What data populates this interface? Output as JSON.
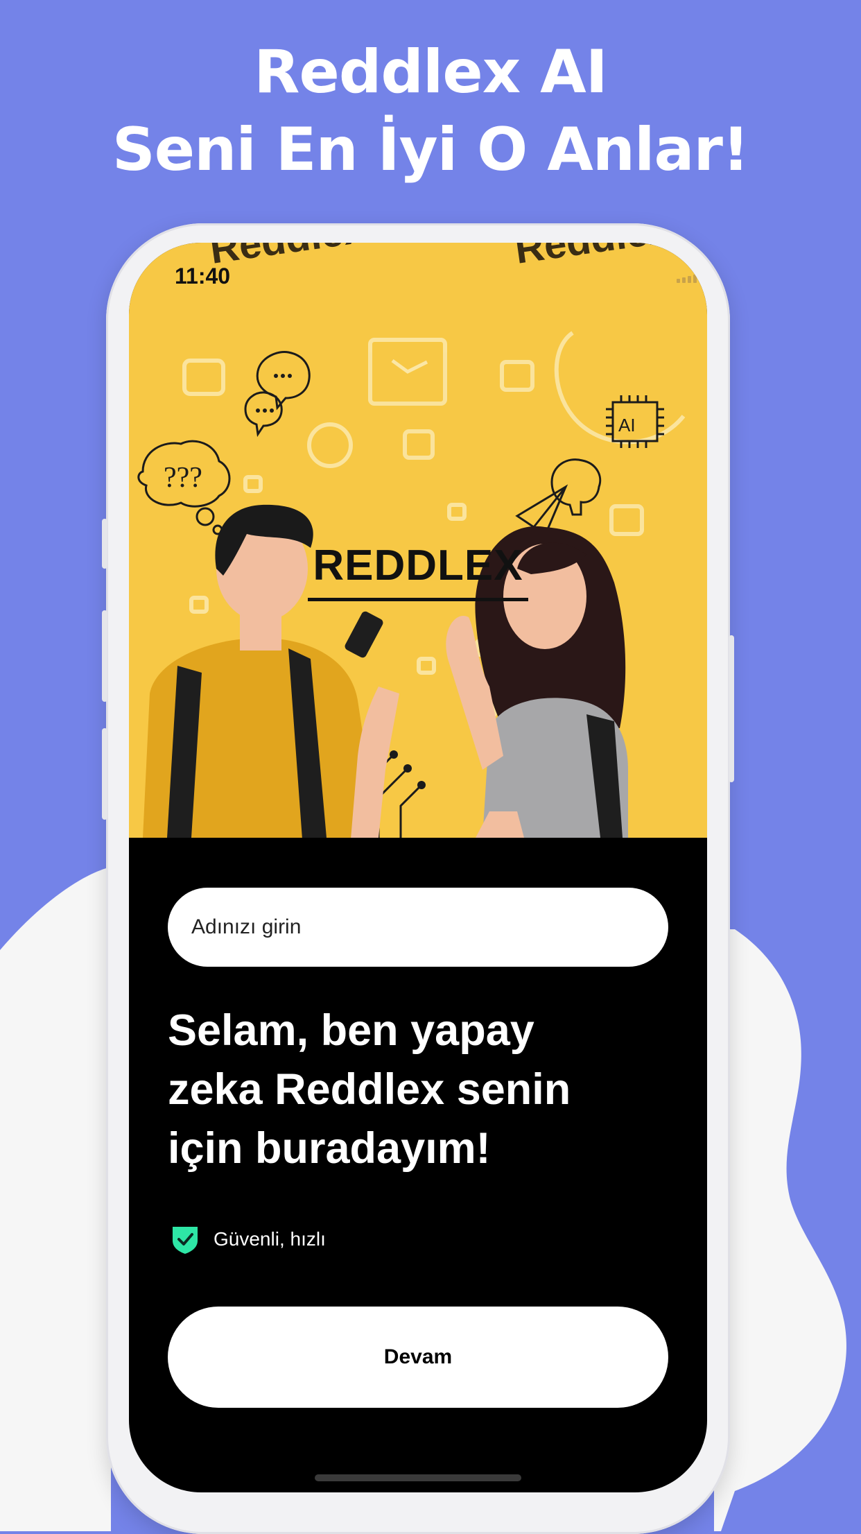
{
  "headline": {
    "line1": "Reddlex AI",
    "line2": "Seni En İyi O Anlar!"
  },
  "status_bar": {
    "time": "11:40",
    "icons": [
      "signal-icon",
      "wifi-icon",
      "battery-icon"
    ]
  },
  "hero": {
    "brand": "REDDLEX",
    "chip_label": "AI",
    "background_word": "Reddlex"
  },
  "form": {
    "name_placeholder": "Adınızı girin"
  },
  "greeting": {
    "line1": "Selam, ben yapay",
    "line2": "zeka Reddlex senin",
    "line3": "için buradayım!"
  },
  "badge": {
    "text": "Güvenli, hızlı",
    "icon": "shield-check-icon"
  },
  "continue_label": "Devam",
  "colors": {
    "background": "#7483E8",
    "hero_yellow": "#F7C845",
    "shield_green": "#2EE6A6",
    "screen_black": "#000000"
  }
}
